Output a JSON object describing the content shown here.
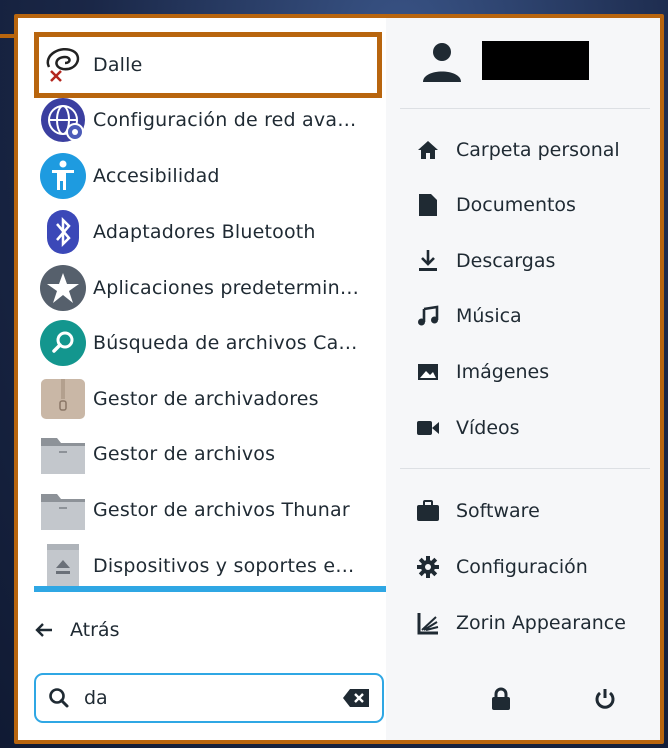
{
  "apps": [
    {
      "label": "Dalle",
      "icon": "dalle-swirl-icon"
    },
    {
      "label": "Configuración de red ava…",
      "icon": "network-settings-icon"
    },
    {
      "label": "Accesibilidad",
      "icon": "accessibility-icon"
    },
    {
      "label": "Adaptadores Bluetooth",
      "icon": "bluetooth-icon"
    },
    {
      "label": "Aplicaciones predetermin…",
      "icon": "star-icon"
    },
    {
      "label": "Búsqueda de archivos Ca…",
      "icon": "file-search-icon"
    },
    {
      "label": "Gestor de archivadores",
      "icon": "archive-icon"
    },
    {
      "label": "Gestor de archivos",
      "icon": "folder-icon"
    },
    {
      "label": "Gestor de archivos Thunar",
      "icon": "folder-icon"
    },
    {
      "label": "Dispositivos y soportes e…",
      "icon": "removable-drive-icon"
    }
  ],
  "back": {
    "label": "Atrás",
    "icon": "arrow-left-icon"
  },
  "search": {
    "value": "da",
    "placeholder": "",
    "icon": "search-icon",
    "clear_icon": "backspace-icon"
  },
  "user": {
    "icon": "user-icon"
  },
  "places": [
    {
      "label": "Carpeta personal",
      "icon": "home-icon"
    },
    {
      "label": "Documentos",
      "icon": "document-icon"
    },
    {
      "label": "Descargas",
      "icon": "download-icon"
    },
    {
      "label": "Música",
      "icon": "music-icon"
    },
    {
      "label": "Imágenes",
      "icon": "image-icon"
    },
    {
      "label": "Vídeos",
      "icon": "video-icon"
    }
  ],
  "system": [
    {
      "label": "Software",
      "icon": "briefcase-icon"
    },
    {
      "label": "Configuración",
      "icon": "gear-icon"
    },
    {
      "label": "Zorin Appearance",
      "icon": "appearance-icon"
    }
  ],
  "bottom": {
    "lock_icon": "lock-icon",
    "power_icon": "power-icon"
  },
  "colors": {
    "accent": "#2fa7e4",
    "highlight_border": "#b8650e",
    "text": "#1f2a33"
  }
}
